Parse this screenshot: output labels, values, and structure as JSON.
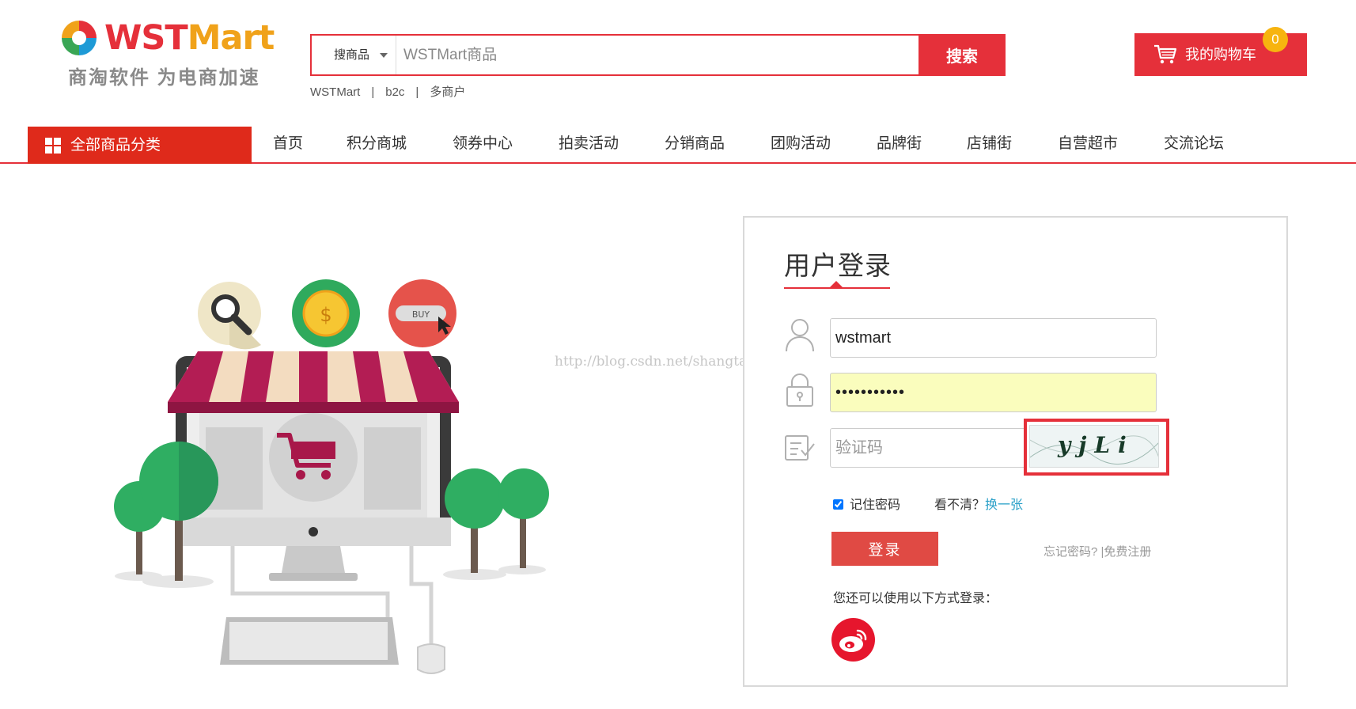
{
  "header": {
    "logo": {
      "brand_part1": "WST",
      "brand_part2": "Mart",
      "slogan": "商淘软件 为电商加速"
    },
    "search": {
      "category": "搜商品",
      "placeholder": "WSTMart商品",
      "button": "搜索",
      "hot_links": [
        "WSTMart",
        "b2c",
        "多商户"
      ],
      "separator": "|"
    },
    "cart": {
      "label": "我的购物车",
      "count": "0",
      "icon": "shopping-cart-icon"
    }
  },
  "nav": {
    "all_categories": "全部商品分类",
    "items": [
      "首页",
      "积分商城",
      "领券中心",
      "拍卖活动",
      "分销商品",
      "团购活动",
      "品牌街",
      "店铺街",
      "自营超市",
      "交流论坛"
    ]
  },
  "illustration": {
    "buy_tag": "BUY",
    "coin_symbol": "$"
  },
  "watermark": "http://blog.csdn.net/shangtaosoft",
  "login": {
    "title": "用户登录",
    "username_value": "wstmart",
    "password_value": "•••••••••••",
    "captcha_placeholder": "验证码",
    "captcha_text": "yjLi",
    "remember_label": "记住密码",
    "remember_checked": true,
    "unclear_label": "看不清？",
    "refresh_label": "换一张",
    "login_button": "登录",
    "forgot_label": "忘记密码?",
    "link_sep": "|",
    "register_label": "免费注册",
    "other_login_label": "您还可以使用以下方式登录："
  },
  "colors": {
    "accent": "#e5303a",
    "nav_category_bg": "#df2a1b",
    "cart_badge": "#f7b40f",
    "link": "#2aa0c8",
    "password_bg": "#fafdbd",
    "weibo": "#e6162d"
  }
}
